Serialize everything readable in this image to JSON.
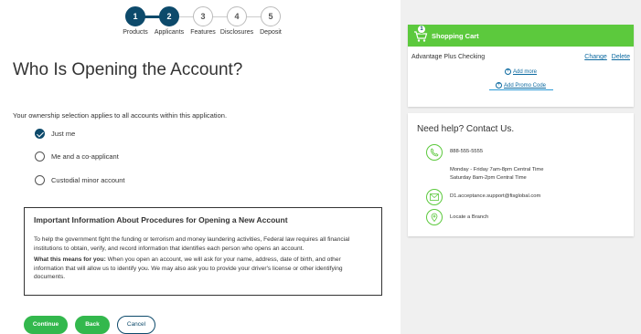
{
  "stepper": {
    "steps": [
      {
        "number": "1",
        "label": "Products",
        "state": "done"
      },
      {
        "number": "2",
        "label": "Applicants",
        "state": "current"
      },
      {
        "number": "3",
        "label": "Features",
        "state": "todo"
      },
      {
        "number": "4",
        "label": "Disclosures",
        "state": "todo"
      },
      {
        "number": "5",
        "label": "Deposit",
        "state": "todo"
      }
    ]
  },
  "main": {
    "title": "Who Is Opening the Account?",
    "intro": "Your ownership selection applies to all accounts within this application.",
    "options": [
      {
        "label": "Just me",
        "checked": true
      },
      {
        "label": "Me and a co-applicant",
        "checked": false
      },
      {
        "label": "Custodial minor account",
        "checked": false
      }
    ],
    "info": {
      "title": "Important Information About Procedures for Opening a New Account",
      "p1": "To help the government fight the funding or terrorism and money laundering activities, Federal law requires all financial institutions to obtain, verify, and record information that identifies each person who opens an account.",
      "p2_bold": "What this means for you:",
      "p2": " When you open an account, we will ask for your name, address, date of birth, and other information that will allow us to identify you. We may also ask you to provide your driver's license or other identifying documents."
    },
    "buttons": {
      "continue": "Continue",
      "back": "Back",
      "cancel": "Cancel"
    }
  },
  "cart": {
    "title": "Shopping Cart",
    "badge": "1",
    "item": "Advantage Plus Checking",
    "change": "Change",
    "delete": "Delete",
    "add_more": "Add more",
    "add_promo": "Add Promo Code"
  },
  "help": {
    "title": "Need help? Contact Us.",
    "phone": "888-555-5555",
    "hours_weekday": "Monday - Friday 7am-8pm Central Time",
    "hours_saturday": "Saturday 8am-2pm Central Time",
    "email": "D1.acceptance.support@fisglobal.com",
    "locate": "Locate a Branch"
  },
  "colors": {
    "primary_navy": "#0d4a6b",
    "accent_green": "#5cc93d",
    "button_green": "#33b84d",
    "link_blue": "#0d6aa0"
  }
}
